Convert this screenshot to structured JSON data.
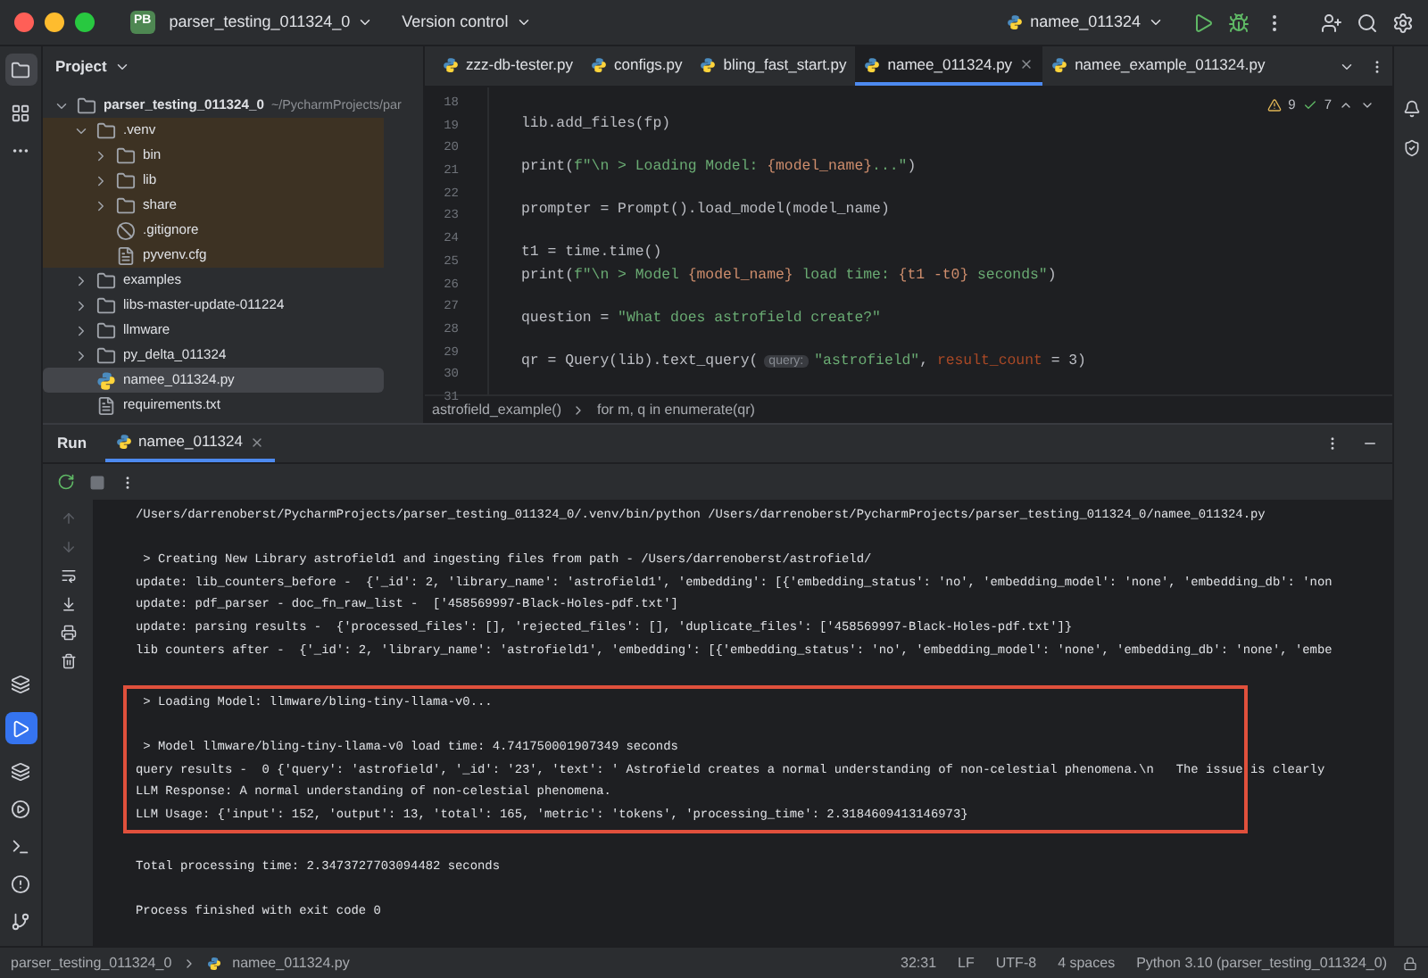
{
  "title_bar": {
    "project_badge": "PB",
    "project": "parser_testing_011324_0",
    "vcs": "Version control",
    "run_config": "namee_011324"
  },
  "project_panel": {
    "title": "Project",
    "tree": [
      {
        "label": "parser_testing_011324_0",
        "path": "~/PycharmProjects/par",
        "kind": "folder",
        "expanded": true,
        "bold": true,
        "children": [
          {
            "label": ".venv",
            "kind": "folder",
            "expanded": true,
            "excluded": true,
            "children": [
              {
                "label": "bin",
                "kind": "folder",
                "expanded": false,
                "excluded": true
              },
              {
                "label": "lib",
                "kind": "folder",
                "expanded": false,
                "excluded": true
              },
              {
                "label": "share",
                "kind": "folder",
                "expanded": false,
                "excluded": true
              },
              {
                "label": ".gitignore",
                "kind": "ignore",
                "excluded": true
              },
              {
                "label": "pyvenv.cfg",
                "kind": "text",
                "excluded": true
              }
            ]
          },
          {
            "label": "examples",
            "kind": "folder",
            "expanded": false
          },
          {
            "label": "libs-master-update-011224",
            "kind": "folder",
            "expanded": false
          },
          {
            "label": "llmware",
            "kind": "folder",
            "expanded": false
          },
          {
            "label": "py_delta_011324",
            "kind": "folder",
            "expanded": false
          },
          {
            "label": "namee_011324.py",
            "kind": "python",
            "selected": true
          },
          {
            "label": "requirements.txt",
            "kind": "text",
            "selected": false
          }
        ]
      }
    ]
  },
  "editor": {
    "tabs": [
      {
        "label": "zzz-db-tester.py",
        "selected": false
      },
      {
        "label": "configs.py",
        "selected": false
      },
      {
        "label": "bling_fast_start.py",
        "selected": false
      },
      {
        "label": "namee_011324.py",
        "selected": true
      },
      {
        "label": "namee_example_011324.py",
        "selected": false
      }
    ],
    "warnings": "9",
    "checks": "7",
    "lines": [
      {
        "number": "18"
      },
      {
        "number": "19",
        "parts": [
          {
            "kind": "code",
            "text": "lib.add_files(fp)"
          }
        ]
      },
      {
        "number": "20"
      },
      {
        "number": "21",
        "parts": [
          {
            "kind": "code",
            "text": "print("
          },
          {
            "kind": "string",
            "text": "f\"\\n > Loading Model: "
          },
          {
            "kind": "brace",
            "text": "{model_name}"
          },
          {
            "kind": "string",
            "text": "...\""
          },
          {
            "kind": "code",
            "text": ")"
          }
        ]
      },
      {
        "number": "22"
      },
      {
        "number": "23",
        "parts": [
          {
            "kind": "code",
            "text": "prompter = Prompt().load_model(model_name)"
          }
        ]
      },
      {
        "number": "24"
      },
      {
        "number": "25",
        "parts": [
          {
            "kind": "code",
            "text": "t1 = time.time()"
          }
        ]
      },
      {
        "number": "26",
        "parts": [
          {
            "kind": "code",
            "text": "print("
          },
          {
            "kind": "string",
            "text": "f\"\\n > Model "
          },
          {
            "kind": "brace",
            "text": "{model_name}"
          },
          {
            "kind": "string",
            "text": " load time: "
          },
          {
            "kind": "brace",
            "text": "{t1 -t0}"
          },
          {
            "kind": "string",
            "text": " seconds\""
          },
          {
            "kind": "code",
            "text": ")"
          }
        ]
      },
      {
        "number": "27"
      },
      {
        "number": "28",
        "parts": [
          {
            "kind": "code",
            "text": "question = "
          },
          {
            "kind": "string",
            "text": "\"What does astrofield create?\""
          }
        ]
      },
      {
        "number": "29"
      },
      {
        "number": "30",
        "parts": [
          {
            "kind": "code",
            "text": "qr = Query(lib).text_query("
          },
          {
            "kind": "hint",
            "text": "query:"
          },
          {
            "kind": "string",
            "text": "\"astrofield\""
          },
          {
            "kind": "code",
            "text": ", "
          },
          {
            "kind": "param",
            "text": "result_count"
          },
          {
            "kind": "code",
            "text": " = 3)"
          }
        ]
      },
      {
        "number": "31"
      }
    ],
    "breadcrumbs": [
      "astrofield_example()",
      "for m, q in enumerate(qr)"
    ]
  },
  "run_panel": {
    "title": "Run",
    "tab": "namee_011324",
    "blocks": [
      {
        "boxed": false,
        "lines": [
          "/Users/darrenoberst/PycharmProjects/parser_testing_011324_0/.venv/bin/python /Users/darrenoberst/PycharmProjects/parser_testing_011324_0/namee_011324.py"
        ]
      },
      {
        "boxed": false,
        "lines": [
          " > Creating New Library astrofield1 and ingesting files from path - /Users/darrenoberst/astrofield/",
          "update: lib_counters_before -  {'_id': 2, 'library_name': 'astrofield1', 'embedding': [{'embedding_status': 'no', 'embedding_model': 'none', 'embedding_db': 'non",
          "update: pdf_parser - doc_fn_raw_list -  ['458569997-Black-Holes-pdf.txt']",
          "update: parsing results -  {'processed_files': [], 'rejected_files': [], 'duplicate_files': ['458569997-Black-Holes-pdf.txt']}",
          "lib counters after -  {'_id': 2, 'library_name': 'astrofield1', 'embedding': [{'embedding_status': 'no', 'embedding_model': 'none', 'embedding_db': 'none', 'embe"
        ]
      },
      {
        "boxed": true,
        "lines": [
          " > Loading Model: llmware/bling-tiny-llama-v0..."
        ]
      },
      {
        "boxed": true,
        "lines": [
          " > Model llmware/bling-tiny-llama-v0 load time: 4.741750001907349 seconds",
          "query results -  0 {'query': 'astrofield', '_id': '23', 'text': ' Astrofield creates a normal understanding of non-celestial phenomena.\\n   The issue is clearly",
          "LLM Response: A normal understanding of non-celestial phenomena.",
          "LLM Usage: {'input': 152, 'output': 13, 'total': 165, 'metric': 'tokens', 'processing_time': 2.3184609413146973}"
        ]
      },
      {
        "boxed": false,
        "lines": [
          "Total processing time: 2.3473727703094482 seconds"
        ]
      },
      {
        "boxed": false,
        "lines": [
          "Process finished with exit code 0"
        ]
      }
    ]
  },
  "status_bar": {
    "breadcrumbs": [
      "parser_testing_011324_0",
      "namee_011324.py"
    ],
    "items": [
      "32:31",
      "LF",
      "UTF-8",
      "4 spaces",
      "Python 3.10 (parser_testing_011324_0)"
    ]
  }
}
